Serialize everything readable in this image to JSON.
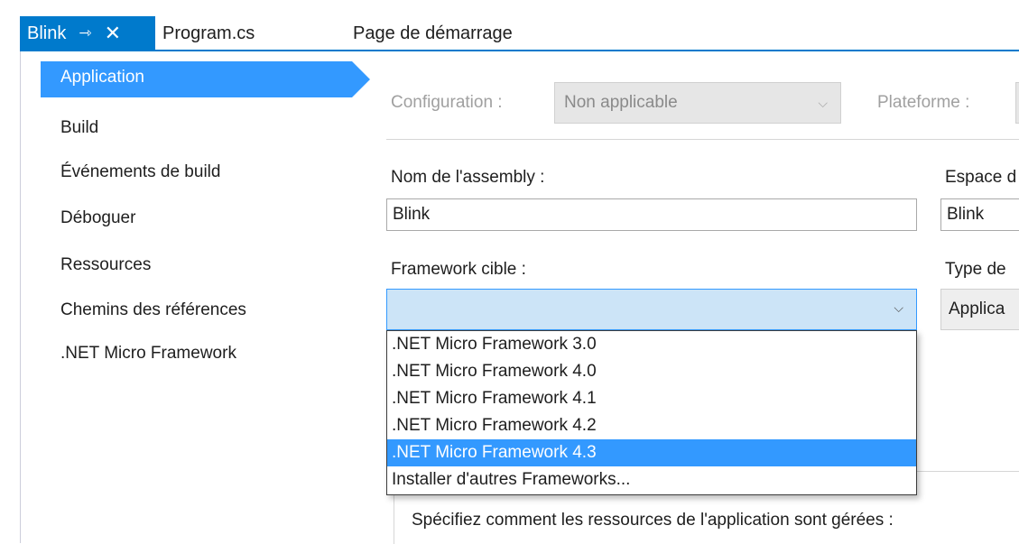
{
  "tabs": {
    "active_label": "Blink",
    "pin_icon": "⇾",
    "close_icon": "✕",
    "program": "Program.cs",
    "start_page": "Page de démarrage"
  },
  "nav": {
    "active": "Application",
    "items": [
      "Build",
      "Événements de build",
      "Déboguer",
      "Ressources",
      "Chemins des références",
      ".NET Micro Framework"
    ]
  },
  "config": {
    "configuration_label": "Configuration :",
    "configuration_value": "Non applicable",
    "platform_label": "Plateforme :"
  },
  "assembly": {
    "label": "Nom de l'assembly :",
    "value": "Blink"
  },
  "namespace": {
    "label": "Espace d",
    "value": "Blink"
  },
  "framework": {
    "label": "Framework cible :",
    "value": "",
    "options": [
      ".NET Micro Framework 3.0",
      ".NET Micro Framework 4.0",
      ".NET Micro Framework 4.1",
      ".NET Micro Framework 4.2",
      ".NET Micro Framework 4.3",
      "Installer d'autres Frameworks..."
    ],
    "selected_index": 4
  },
  "output_type": {
    "label": "Type de",
    "value": "Applica"
  },
  "resources_text": "Spécifiez comment les ressources de l'application sont gérées :",
  "colors": {
    "accent": "#007acc",
    "selection": "#3399ff",
    "dropdown_bg": "#cce4f7"
  }
}
